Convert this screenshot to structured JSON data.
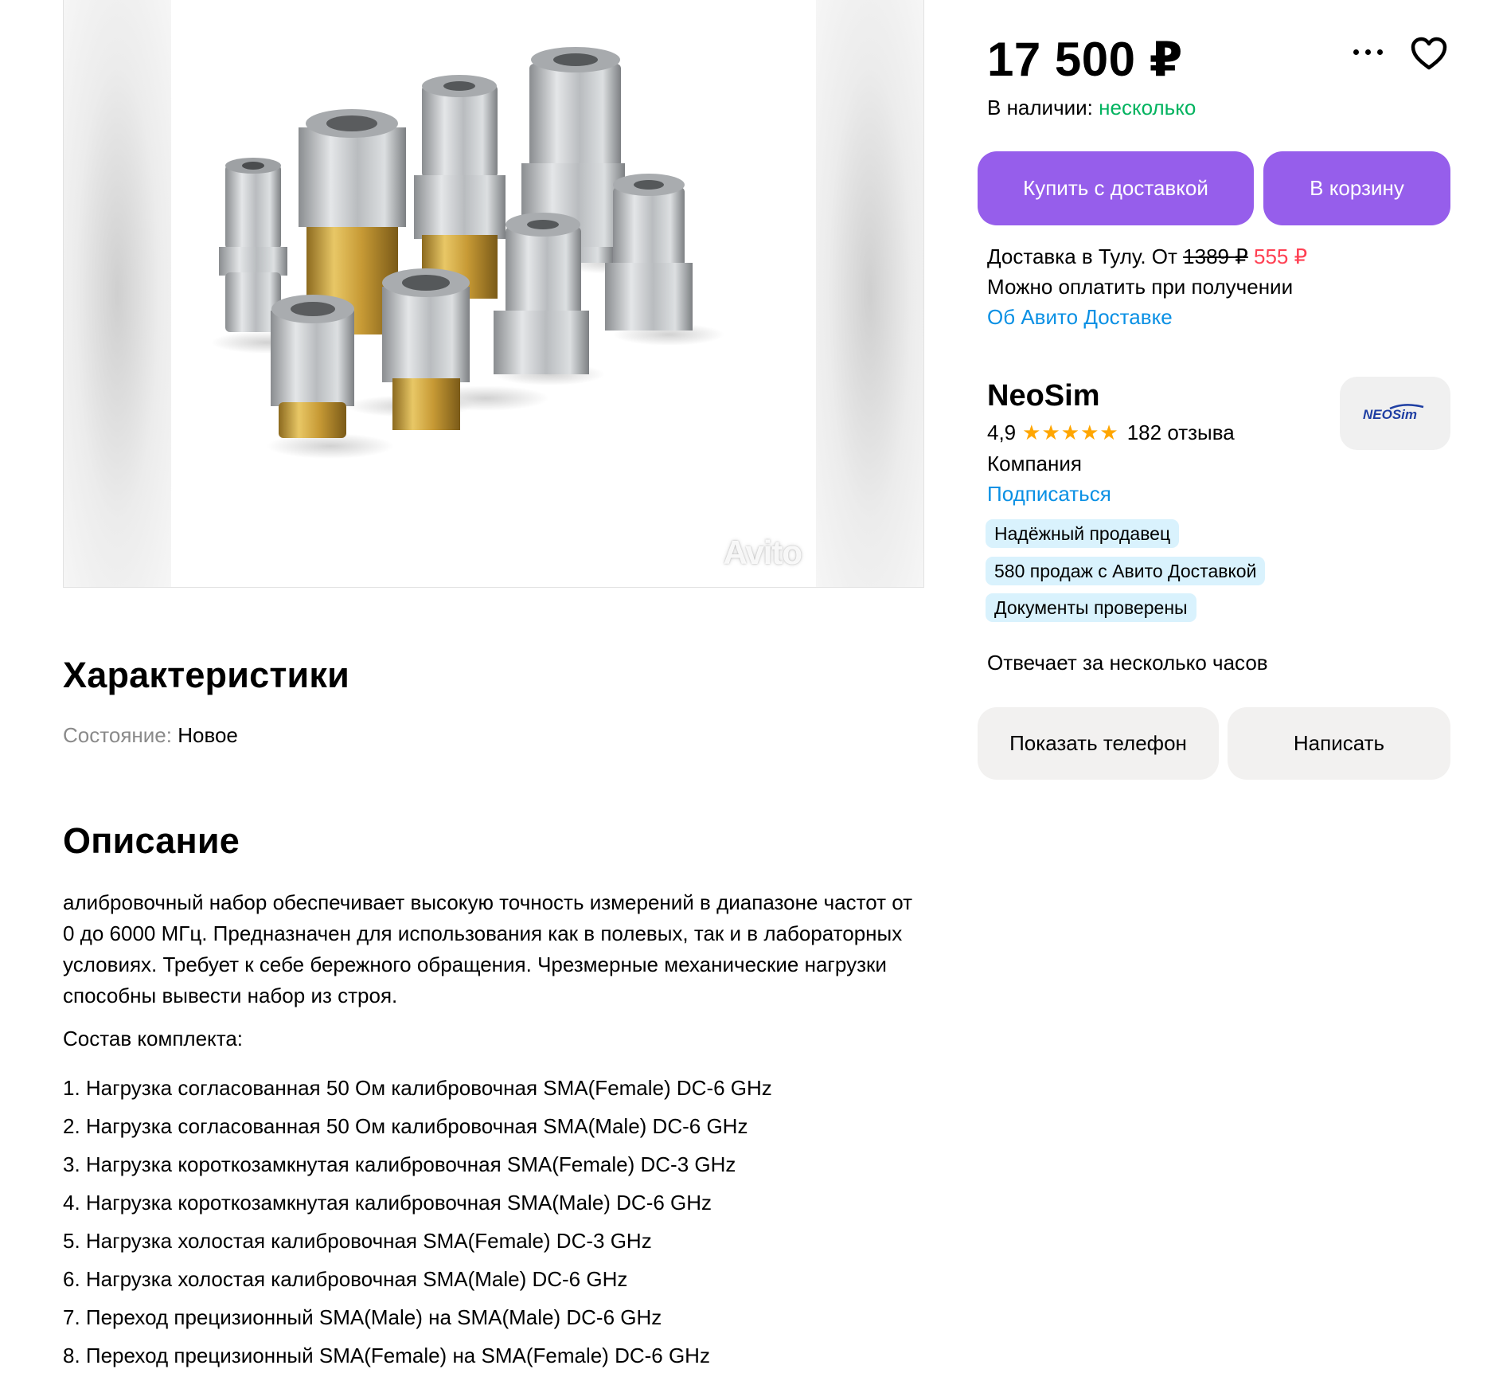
{
  "gallery": {
    "watermark": "Avito"
  },
  "characteristics": {
    "title": "Характеристики",
    "condition_key": "Состояние:",
    "condition_value": "Новое"
  },
  "description": {
    "title": "Описание",
    "text": "алибровочный набор обеспечивает высокую точность измерений в диапазоне частот от 0 до 6000 МГц. Предназначен для использования как в полевых, так и в лабораторных условиях. Требует к себе бережного обращения. Чрезмерные механические нагрузки способны вывести набор из строя.",
    "kit_title": "Состав комплекта:",
    "kit_items": [
      "1. Нагрузка согласованная 50 Ом калибровочная SMA(Female) DC-6 GHz",
      "2. Нагрузка согласованная 50 Ом калибровочная SMA(Male) DC-6 GHz",
      "3. Нагрузка короткозамкнутая калибровочная SMA(Female) DC-3 GHz",
      "4. Нагрузка короткозамкнутая калибровочная SMA(Male) DC-6 GHz",
      "5. Нагрузка холостая калибровочная SMA(Female) DC-3 GHz",
      "6. Нагрузка холостая калибровочная SMA(Male) DC-6 GHz",
      "7. Переход прецизионный SMA(Male) на SMA(Male) DC-6 GHz",
      "8. Переход прецизионный SMA(Female) на SMA(Female) DC-6 GHz"
    ]
  },
  "offer": {
    "price": "17 500 ₽",
    "stock_label": "В наличии:",
    "stock_value": "несколько",
    "buy_button": "Купить с доставкой",
    "cart_button": "В корзину",
    "delivery_prefix": "Доставка в Тулу. От",
    "delivery_old_price": "1389 ₽",
    "delivery_new_price": "555 ₽",
    "pay_on_receipt": "Можно оплатить при получении",
    "about_delivery_link": "Об Авито Доставке"
  },
  "seller": {
    "name": "NeoSim",
    "rating": "4,9",
    "stars": 5,
    "reviews": "182 отзыва",
    "type": "Компания",
    "subscribe_link": "Подписаться",
    "logo_text": "NEOSim",
    "badges": [
      "Надёжный продавец",
      "580 продаж с Авито Доставкой",
      "Документы проверены"
    ],
    "response_time": "Отвечает за несколько часов",
    "show_phone_button": "Показать телефон",
    "write_button": "Написать"
  },
  "colors": {
    "accent_purple": "#965eeb",
    "stock_green": "#02b35f",
    "discount_red": "#ff4053",
    "link_blue": "#0a90e4",
    "badge_bg": "#d9f2fd",
    "star_orange": "#ffa600"
  },
  "icons": {
    "more": "more-dots-icon",
    "favorite": "heart-icon",
    "star": "star-icon"
  }
}
